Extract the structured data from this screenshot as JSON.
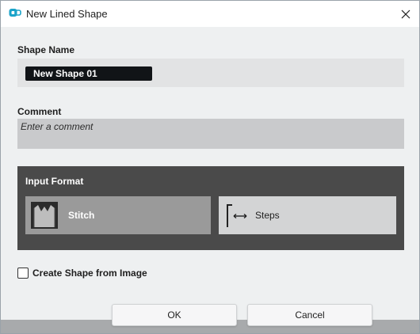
{
  "window": {
    "title": "New Lined Shape"
  },
  "shape_name": {
    "label": "Shape Name",
    "value": "New Shape 01"
  },
  "comment": {
    "label": "Comment",
    "placeholder": "Enter a comment"
  },
  "input_format": {
    "title": "Input Format",
    "options": [
      {
        "label": "Stitch",
        "icon": "stitch-icon",
        "selected": true
      },
      {
        "label": "Steps",
        "icon": "steps-icon",
        "selected": false
      }
    ]
  },
  "create_from_image": {
    "label": "Create Shape from Image",
    "checked": false
  },
  "buttons": {
    "ok": "OK",
    "cancel": "Cancel"
  },
  "colors": {
    "accent": "#1aa3c9",
    "panel": "#4a4a4a",
    "selected_option": "#9a9a9a"
  }
}
